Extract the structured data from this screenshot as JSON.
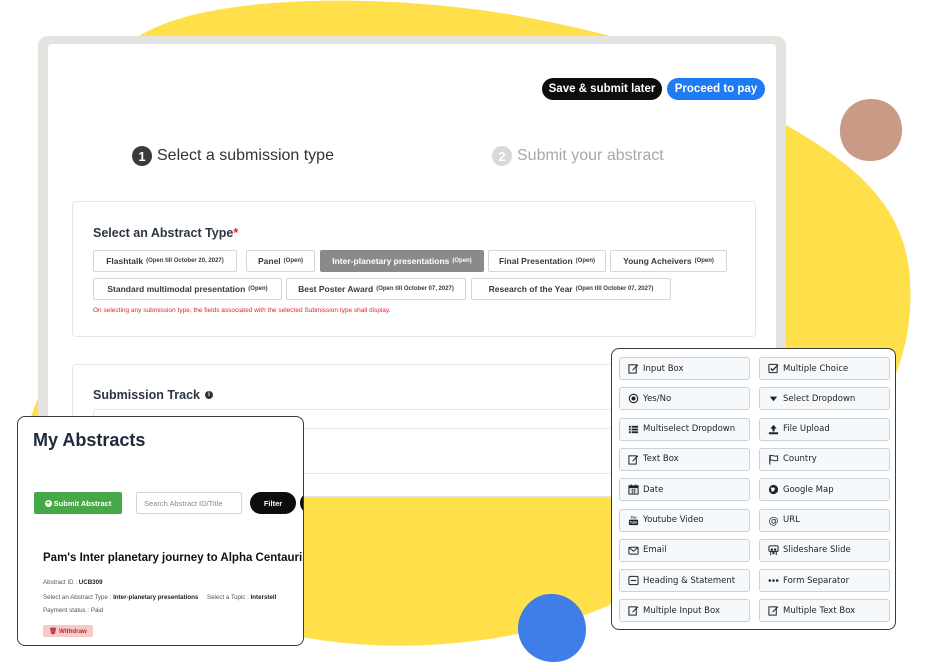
{
  "header": {
    "save_label": "Save & submit later",
    "pay_label": "Proceed to pay"
  },
  "steps": [
    {
      "num": "1",
      "label": "Select a submission type"
    },
    {
      "num": "2",
      "label": "Submit your abstract"
    }
  ],
  "abstract_type": {
    "title": "Select an Abstract Type",
    "required_mark": "*",
    "chips": [
      {
        "label": "Flashtalk",
        "status": "(Open till October 20, 2027)"
      },
      {
        "label": "Panel",
        "status": "(Open)"
      },
      {
        "label": "Inter-planetary presentations",
        "status": "(Open)"
      },
      {
        "label": "Final Presentation",
        "status": "(Open)"
      },
      {
        "label": "Young Acheivers",
        "status": "(Open)"
      },
      {
        "label": "Standard multimodal presentation",
        "status": "(Open)"
      },
      {
        "label": "Best Poster Award",
        "status": "(Open till October 07, 2027)"
      },
      {
        "label": "Research of the Year",
        "status": "(Open till October 07, 2027)"
      }
    ],
    "note": "On selecting any submission type, the fields associated with the selected Submission type shall display."
  },
  "track": {
    "title": "Submission Track"
  },
  "abstracts": {
    "title": "My Abstracts",
    "submit_label": "Submit Abstract",
    "search_placeholder": "Search Abstract ID/Title",
    "filter_label": "Filter",
    "item": {
      "title": "Pam's Inter planetary journey to Alpha Centauri",
      "id_label": "Abstract ID :",
      "id_value": "UCB309",
      "type_label": "Select an Abstract Type :",
      "type_value": "Inter-planetary presentations",
      "topic_label": "Select a Topic :",
      "topic_value": "Interstell",
      "payment_label": "Payment status :",
      "payment_value": "Paid",
      "withdraw_label": "Withdraw"
    }
  },
  "field_types": [
    {
      "label": "Input Box",
      "icon": "edit-icon"
    },
    {
      "label": "Multiple Choice",
      "icon": "checkbox-icon"
    },
    {
      "label": "Yes/No",
      "icon": "radio-icon"
    },
    {
      "label": "Select Dropdown",
      "icon": "caret-down-icon"
    },
    {
      "label": "Multiselect Dropdown",
      "icon": "list-icon"
    },
    {
      "label": "File Upload",
      "icon": "upload-icon"
    },
    {
      "label": "Text Box",
      "icon": "edit-icon"
    },
    {
      "label": "Country",
      "icon": "flag-icon"
    },
    {
      "label": "Date",
      "icon": "calendar-icon"
    },
    {
      "label": "Google Map",
      "icon": "globe-icon"
    },
    {
      "label": "Youtube Video",
      "icon": "youtube-icon"
    },
    {
      "label": "URL",
      "icon": "at-icon"
    },
    {
      "label": "Email",
      "icon": "envelope-icon"
    },
    {
      "label": "Slideshare Slide",
      "icon": "slideshare-icon"
    },
    {
      "label": "Heading & Statement",
      "icon": "heading-icon"
    },
    {
      "label": "Form Separator",
      "icon": "ellipsis-icon"
    },
    {
      "label": "Multiple Input Box",
      "icon": "edit-icon"
    },
    {
      "label": "Multiple Text Box",
      "icon": "edit-icon"
    }
  ],
  "colors": {
    "yellow": "#ffe04b",
    "blue": "#1e7bf2",
    "green": "#47a847",
    "red": "#e0242c",
    "tan": "#c99a86"
  }
}
